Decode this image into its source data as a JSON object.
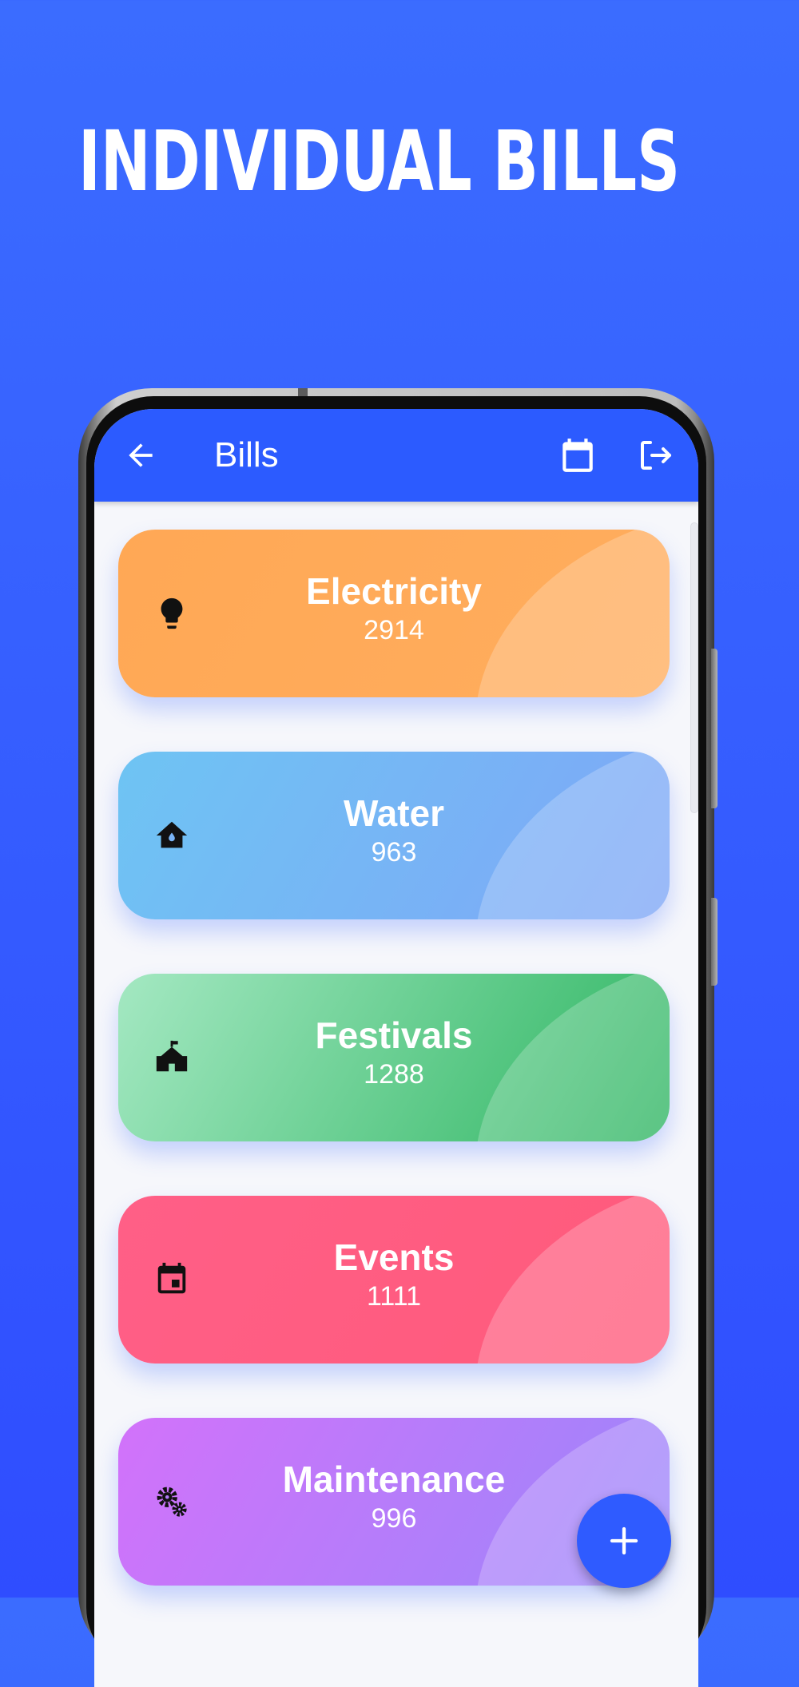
{
  "promo": {
    "headline": "INDIVIDUAL BILLS"
  },
  "appbar": {
    "title": "Bills",
    "back_icon": "arrow-back-icon",
    "calendar_icon": "calendar-icon",
    "logout_icon": "logout-icon",
    "color": "#2c5bff"
  },
  "bills": [
    {
      "name": "Electricity",
      "amount": "2914",
      "icon": "lightbulb-icon",
      "gradient": [
        "#ffa855",
        "#ffad5e"
      ]
    },
    {
      "name": "Water",
      "amount": "963",
      "icon": "water-home-icon",
      "gradient": [
        "#6ec4f3",
        "#7fa6f7"
      ]
    },
    {
      "name": "Festivals",
      "amount": "1288",
      "icon": "school-house-icon",
      "gradient": [
        "#a4e8c2",
        "#2db561"
      ]
    },
    {
      "name": "Events",
      "amount": "1111",
      "icon": "event-calendar-icon",
      "gradient": [
        "#ff5f87",
        "#ff5a7b"
      ]
    },
    {
      "name": "Maintenance",
      "amount": "996",
      "icon": "gears-icon",
      "gradient": [
        "#d272fa",
        "#9b86fa"
      ]
    }
  ],
  "fab": {
    "icon": "plus-icon"
  }
}
